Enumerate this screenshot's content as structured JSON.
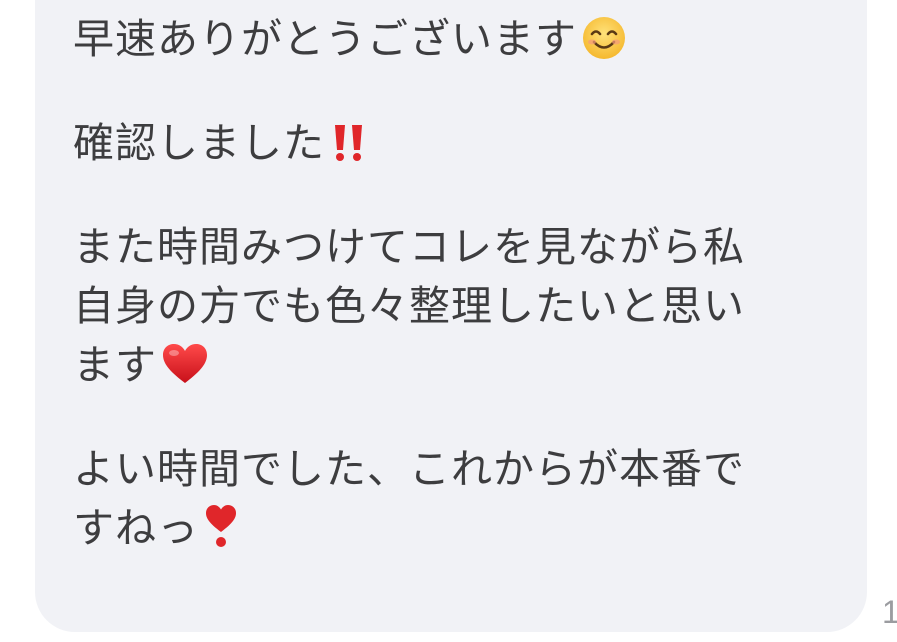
{
  "message": {
    "paragraph_1": {
      "line_1": "早速ありがとうございます",
      "line_1_emoji": "smiling-face-icon"
    },
    "paragraph_2": {
      "line_1": "確認しました",
      "line_1_emoji": "double-exclamation-icon"
    },
    "paragraph_3": {
      "line_1": "また時間みつけてコレを見ながら私",
      "line_2": "自身の方でも色々整理したいと思い",
      "line_3": "ます",
      "line_3_emoji": "red-heart-icon"
    },
    "paragraph_4": {
      "line_1": "よい時間でした、これからが本番で",
      "line_2": "すねっ",
      "line_2_emoji": "heart-exclamation-icon"
    }
  },
  "read_count": "1",
  "colors": {
    "bubble_background": "#f1f2f6",
    "text": "#3d3d3f",
    "read_count": "#9b9ca0"
  }
}
